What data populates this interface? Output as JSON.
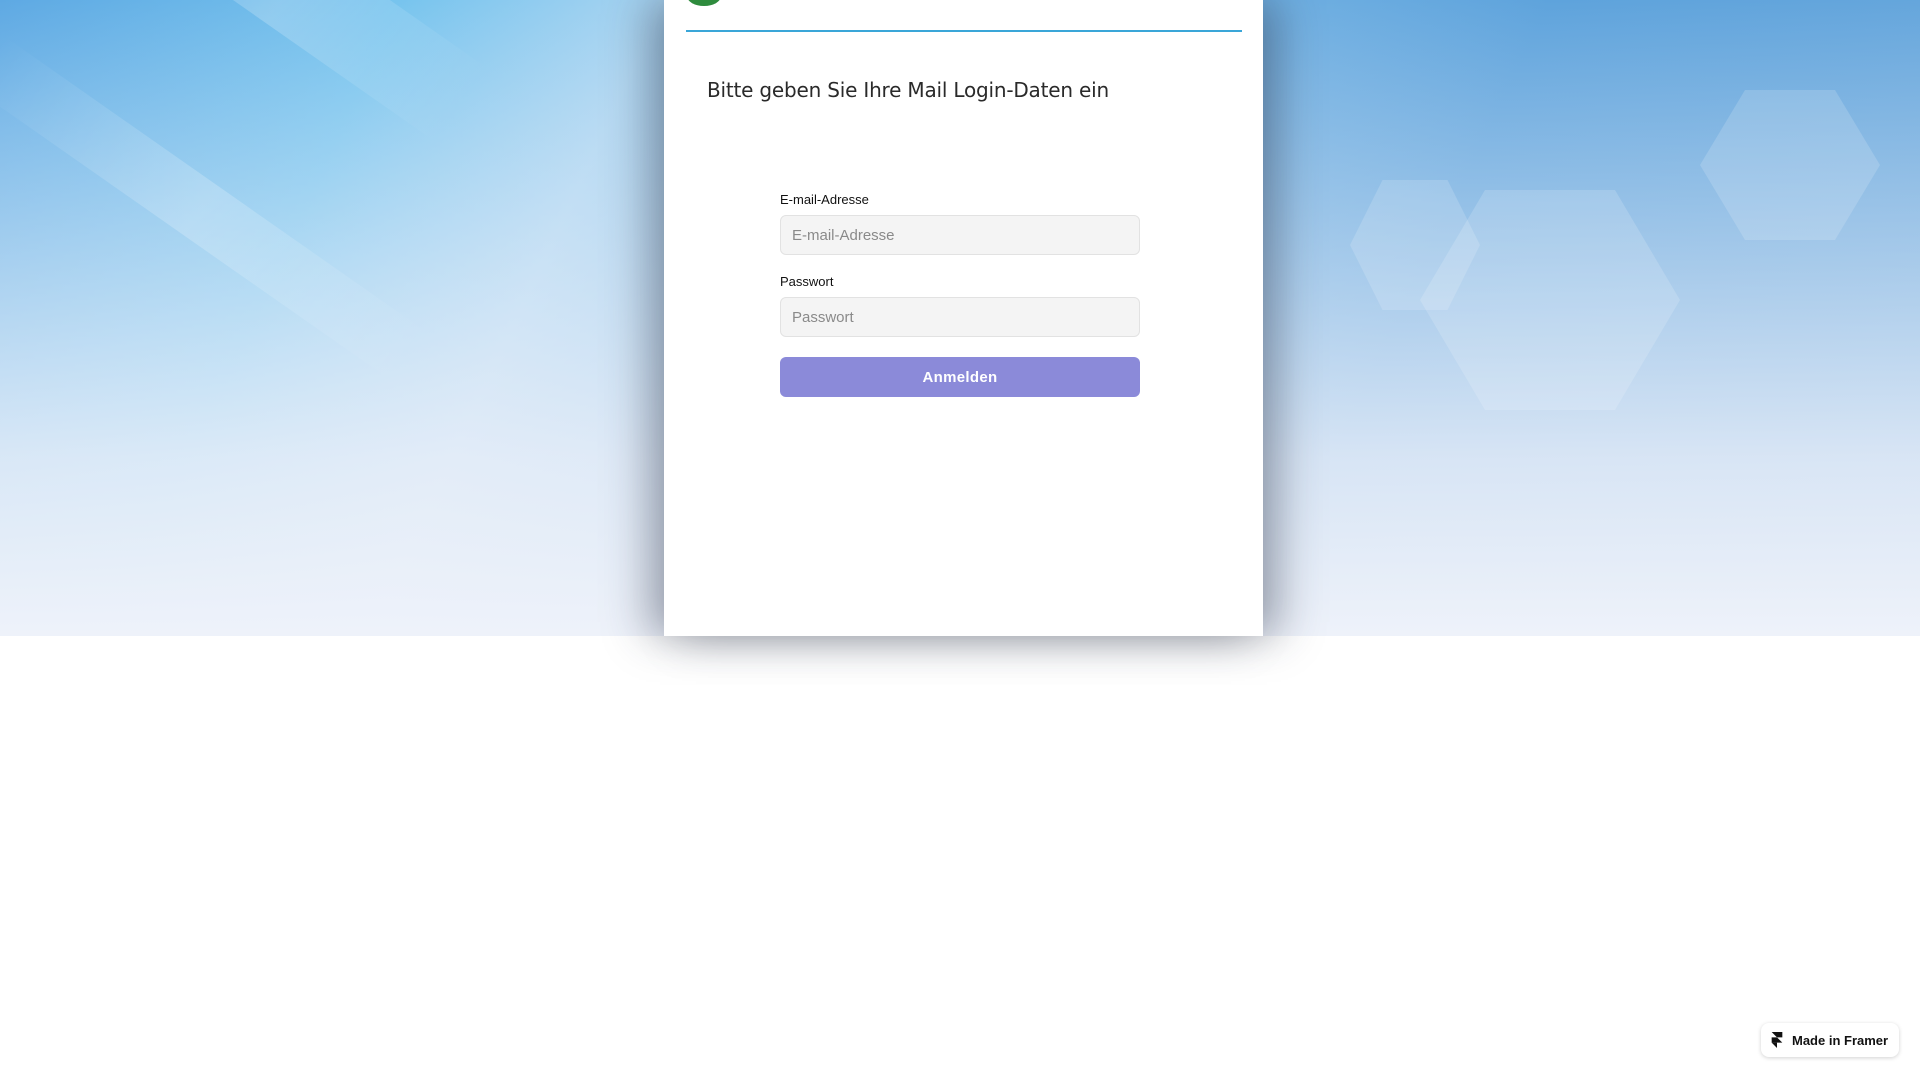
{
  "login": {
    "heading": "Bitte geben Sie Ihre Mail Login-Daten ein",
    "email_label": "E-mail-Adresse",
    "email_placeholder": "E-mail-Adresse",
    "email_value": "",
    "password_label": "Passwort",
    "password_placeholder": "Passwort",
    "password_value": "",
    "submit_label": "Anmelden"
  },
  "badge": {
    "label": "Made in Framer",
    "icon": "framer-logo-icon"
  },
  "logo": {
    "icon": "shield-logo-icon"
  },
  "colors": {
    "accent_line": "#3aa6d8",
    "button": "#8b8ad9",
    "button_text": "#ffffff",
    "background_top": "#5ea9e3",
    "background_fade": "#eef2fa"
  }
}
